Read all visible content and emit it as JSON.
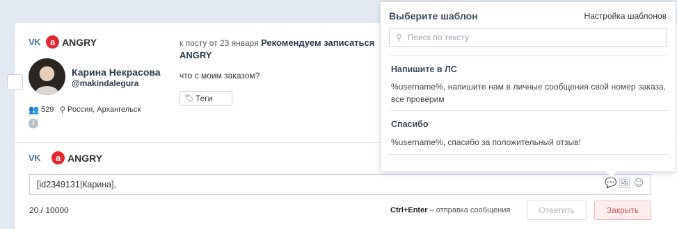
{
  "brand": {
    "name": "ANGRY",
    "logo_letter": "a",
    "network": "vk",
    "network_label": "VK"
  },
  "author": {
    "name": "Карина Некрасова",
    "handle": "@makindalegura",
    "friends_count": "529",
    "location": "Россия, Архангельск"
  },
  "post": {
    "meta": "к посту от 23 января",
    "title_part1": "Рекомендуем записаться",
    "title_part2": "ANGRY",
    "comment": "что с моим заказом?",
    "tags_label": "Теги"
  },
  "reply": {
    "brand_name": "ANGRY",
    "input_value": "[id2349131|Карина],",
    "counter": "20 / 10000",
    "hint_keys": "Ctrl+Enter",
    "hint_text": "– отправка сообщения",
    "reply_button": "Ответить",
    "close_button": "Закрыть",
    "icons": [
      "chat-icon",
      "image-icon",
      "emoji-icon"
    ]
  },
  "templates_popover": {
    "title": "Выберите шаблон",
    "settings_link": "Настройка шаблонов",
    "search_placeholder": "Поиск по тексту",
    "items": [
      {
        "title": "Напишите в ЛС",
        "body": "%username%, напишите нам в личные сообщения свой номер заказа, все проверим"
      },
      {
        "title": "Спасибо",
        "body": "%username%, спасибо за положительный отзыв!"
      }
    ]
  },
  "colors": {
    "accent_red": "#e1262d",
    "vk_blue": "#4a76a8",
    "close_text": "#d9534f",
    "background": "#dfe7f0"
  }
}
